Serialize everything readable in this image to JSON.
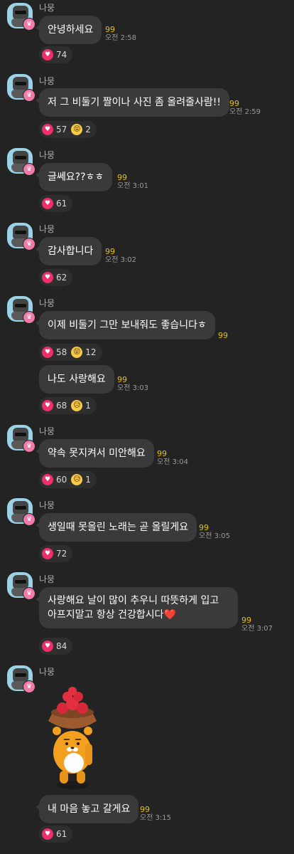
{
  "sender": "나뭉",
  "messages": [
    {
      "text": "안녕하세요",
      "unread": "99",
      "time": "오전 2:58",
      "likes": "74"
    },
    {
      "text": "저 그 비둘기 짤이나 사진 좀 올려줄사람!!",
      "unread": "99",
      "time": "오전 2:59",
      "likes": "57",
      "emoji_count": "2"
    },
    {
      "text": "글쎄요??ㅎㅎ",
      "unread": "99",
      "time": "오전 3:01",
      "likes": "61"
    },
    {
      "text": "감사합니다",
      "unread": "99",
      "time": "오전 3:02",
      "likes": "62"
    },
    {
      "text": "이제 비둘기 그만 보내줘도 좋습니다ㅎ",
      "unread": "99",
      "likes": "58",
      "emoji_count": "12"
    },
    {
      "text": "나도 사랑해요",
      "unread": "99",
      "time": "오전 3:03",
      "likes": "68",
      "emoji_count": "1"
    },
    {
      "text": "약속 못지켜서 미안해요",
      "unread": "99",
      "time": "오전 3:04",
      "likes": "60",
      "emoji_count": "1"
    },
    {
      "text": "생일때 못올린 노래는 곧 올릴게요",
      "unread": "99",
      "time": "오전 3:05",
      "likes": "72"
    },
    {
      "text": "사랑해요 날이 많이 추우니 따뜻하게 입고 아프지말고 항상 건강합시다❤️",
      "unread": "99",
      "time": "오전 3:07",
      "likes": "84"
    },
    {
      "text": "내 마음 놓고 갈게요",
      "unread": "99",
      "time": "오전 3:15",
      "likes": "61"
    }
  ],
  "icons": {
    "like": "heart-icon",
    "crown": "crown-badge-icon",
    "emoji_laugh": "laughing-emoji-icon",
    "emoji_sad": "sad-emoji-icon"
  },
  "colors": {
    "background": "#232323",
    "bubble": "#3a3a3a",
    "unread": "#e6c200",
    "heart": "#ee2f6a"
  }
}
